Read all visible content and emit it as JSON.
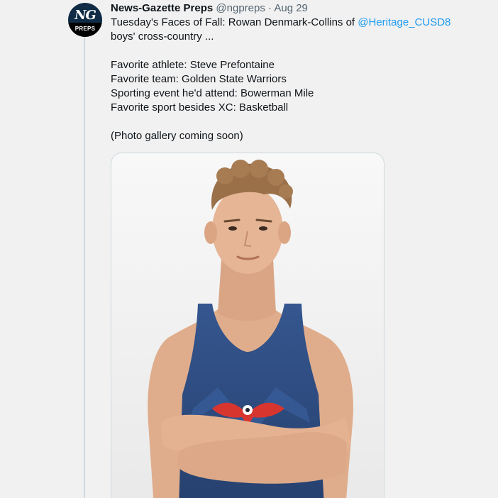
{
  "tweet": {
    "author": {
      "display_name": "News-Gazette Preps",
      "handle": "@ngpreps",
      "avatar_logo_text": "NG",
      "avatar_badge_text": "PREPS"
    },
    "separator": "·",
    "date": "Aug 29",
    "text": {
      "line1": "Tuesday's Faces of Fall: Rowan Denmark-Collins of ",
      "mention": "@Heritage_CUSD8",
      "line2": "boys' cross-country ...",
      "line3": "Favorite athlete: Steve Prefontaine",
      "line4": "Favorite team: Golden State Warriors",
      "line5": "Sporting event he'd attend: Bowerman Mile",
      "line6": "Favorite sport besides XC: Basketball",
      "line7": "(Photo gallery coming soon)"
    },
    "media": {
      "kind": "photo",
      "colors": {
        "background": "#f2f2f2",
        "skin": "#e2b08f",
        "hair": "#9a7049",
        "jersey": "#2f4f8a",
        "logo_red": "#d8352f"
      }
    }
  }
}
